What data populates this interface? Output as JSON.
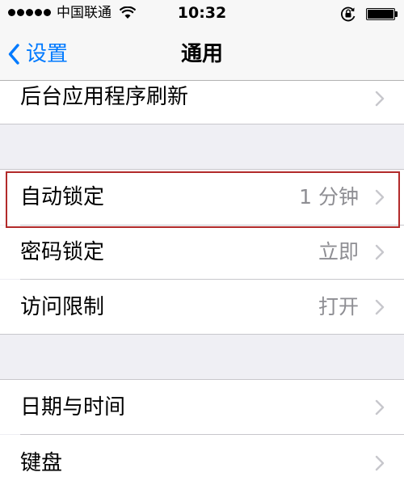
{
  "status_bar": {
    "carrier": "中国联通",
    "time": "10:32",
    "battery_level": 1.0
  },
  "nav_bar": {
    "back_label": "设置",
    "title": "通用"
  },
  "groups": [
    {
      "rows": [
        {
          "label": "后台应用程序刷新",
          "value": ""
        }
      ]
    },
    {
      "rows": [
        {
          "label": "自动锁定",
          "value": "1 分钟",
          "highlighted": true
        },
        {
          "label": "密码锁定",
          "value": "立即"
        },
        {
          "label": "访问限制",
          "value": "打开"
        }
      ]
    },
    {
      "rows": [
        {
          "label": "日期与时间",
          "value": ""
        },
        {
          "label": "键盘",
          "value": ""
        }
      ]
    }
  ],
  "colors": {
    "accent": "#007aff",
    "highlight_border": "#b22a2a",
    "background": "#efeff4",
    "secondary_text": "#8e8e93"
  }
}
